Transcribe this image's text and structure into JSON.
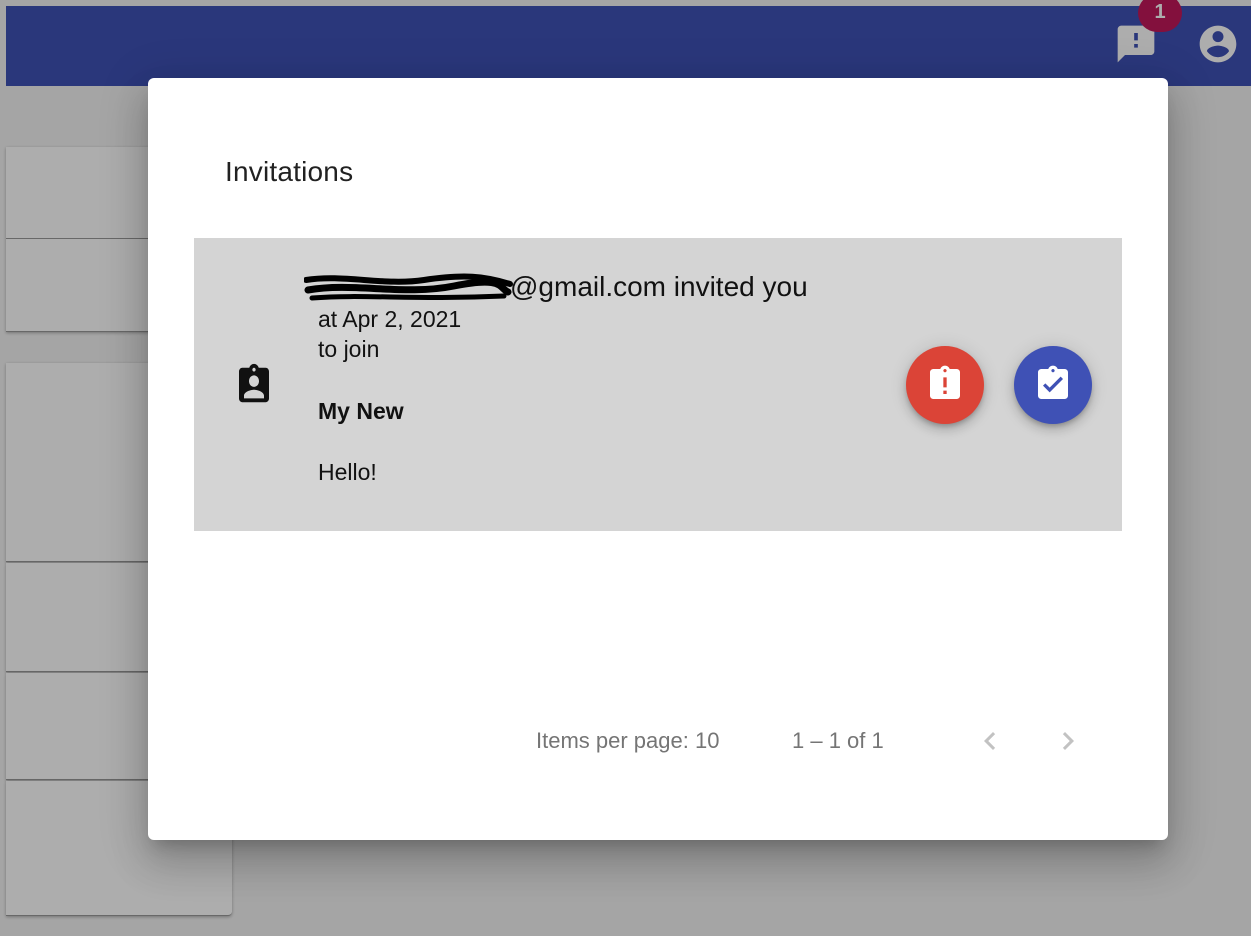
{
  "colors": {
    "primary": "#3f51b5",
    "warn": "#db4437",
    "badge": "#c2185b",
    "row_background": "#d4d4d4"
  },
  "toolbar": {
    "feedback_icon": "feedback-icon",
    "badge_count": "1",
    "account_icon": "account-circle-icon"
  },
  "dialog": {
    "title": "Invitations",
    "invitation": {
      "icon": "assignment-ind-icon",
      "email_line": "@gmail.com invited you",
      "date_line": "at Apr 2, 2021",
      "join_line": "to join",
      "group_name": "My New",
      "message": "Hello!",
      "decline_icon": "assignment-late-icon",
      "accept_icon": "assignment-turned-in-icon"
    },
    "paginator": {
      "items_per_page_label": "Items per page: 10",
      "range_label": "1 – 1 of 1",
      "prev_icon": "chevron-left-icon",
      "next_icon": "chevron-right-icon"
    }
  }
}
